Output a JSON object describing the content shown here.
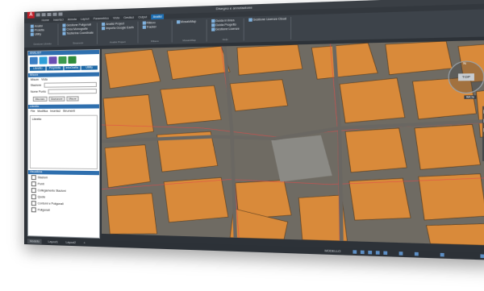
{
  "app": {
    "title": "Disegno e annotazione",
    "accent": "#1e6fb3",
    "logo": "A"
  },
  "tabs": [
    "Home",
    "Inserisci",
    "Annota",
    "Layout",
    "Parametrico",
    "Vista",
    "Gestisci",
    "Output",
    "Analisi"
  ],
  "active_tab": "Analisi",
  "ribbon": [
    {
      "items": [
        "Analisi",
        "Proietta",
        "Utility"
      ],
      "title": "Gestione Libretto"
    },
    {
      "items": [
        "Gestione Poligonali",
        "Crea Monografie",
        "Tastierina Coordinate"
      ],
      "title": "Strumenti"
    },
    {
      "items": [
        "Analisi Project",
        "Importa Google Earth"
      ],
      "title": "Analisi Project"
    },
    {
      "items": [
        "Rilievo",
        "Tracker"
      ],
      "title": "Rilievo"
    },
    {
      "items": [
        "MosaicMap"
      ],
      "title": "MosaicMap"
    },
    {
      "items": [
        "Guida in linea",
        "Guida Progetto",
        "Gestione Licenze"
      ],
      "title": "Help"
    },
    {
      "items": [
        "Gestione Licenze Cloud"
      ],
      "title": ""
    }
  ],
  "left_panel": {
    "header": "ANALIST",
    "tabs": [
      "Libretto",
      "Proprietà",
      "InfoGrafia",
      "Utility"
    ],
    "misura": {
      "title": "Misura",
      "subtabs": [
        "Misure",
        "Vista"
      ],
      "stazione_label": "Stazione",
      "punto_label": "Nome Punto",
      "buttons": [
        "Misurare",
        "Stazionare",
        "Misure"
      ]
    },
    "libretto": {
      "title": "Libretto",
      "menu": [
        "File",
        "Modifica",
        "Inserisci",
        "Strumenti"
      ],
      "content": "Libretto"
    },
    "visualizza": {
      "title": "Visualizza",
      "items": [
        "Stazioni",
        "Punti",
        "Collegamento Stazioni",
        "Quote",
        "Contorni e Poligonali",
        "Poligonali"
      ]
    }
  },
  "map": {
    "compass_label": "N",
    "view_label": "TOP",
    "wcs": "WCS"
  },
  "statusbar": {
    "tabs": [
      "Modello",
      "Layout1",
      "Layout2",
      "+"
    ],
    "scale": "MODELLO"
  }
}
